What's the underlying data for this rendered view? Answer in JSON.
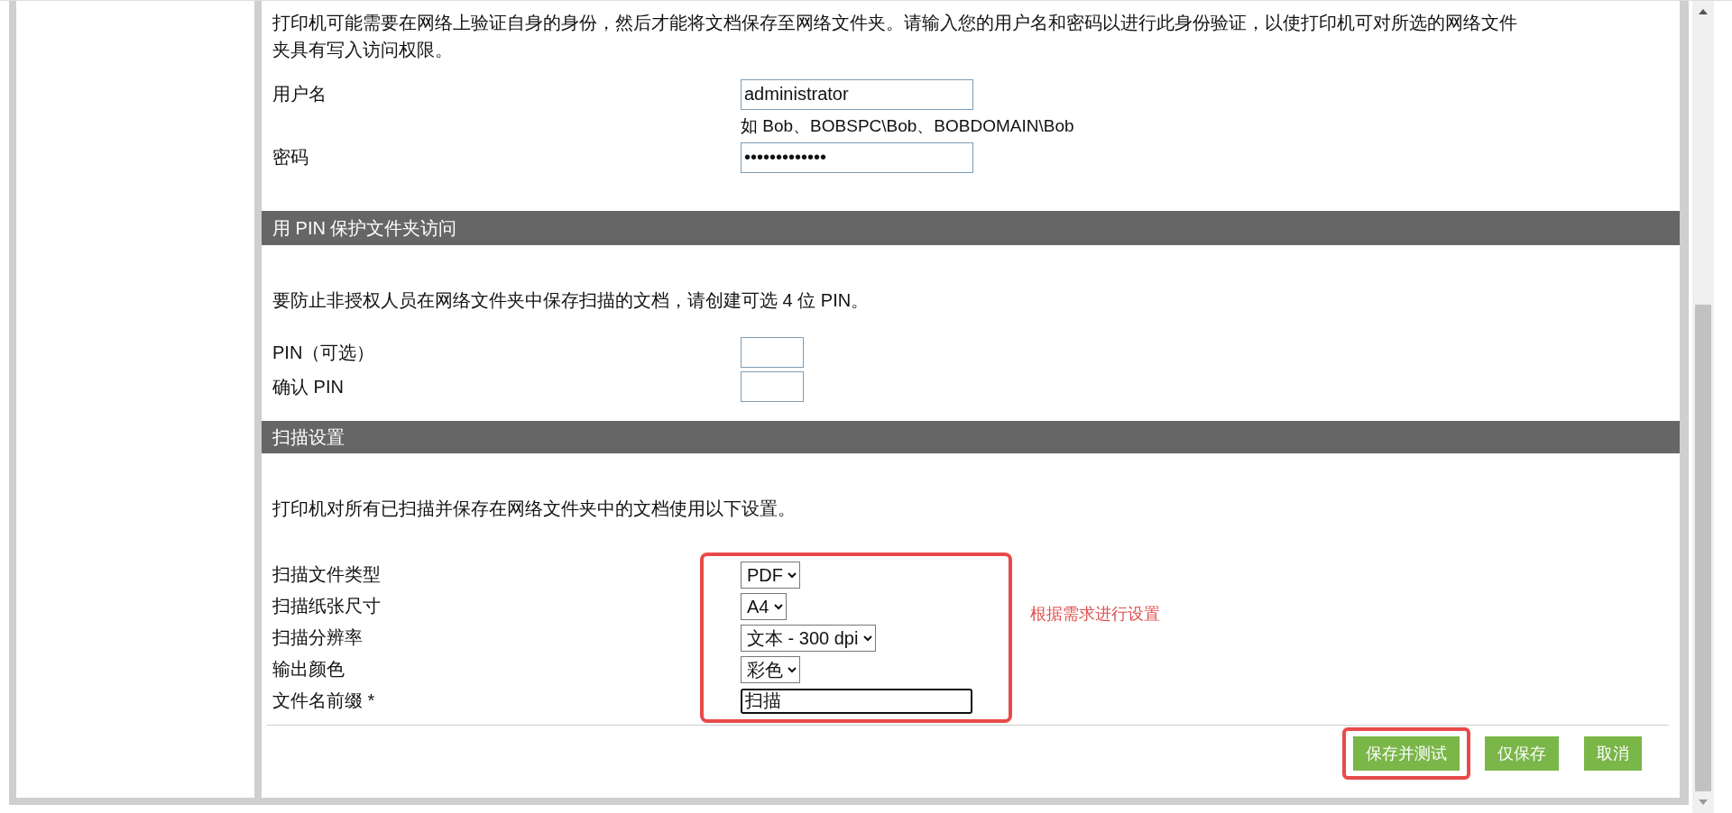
{
  "intro": "打印机可能需要在网络上验证自身的身份，然后才能将文档保存至网络文件夹。请输入您的用户名和密码以进行此身份验证，以使打印机可对所选的网络文件夹具有写入访问权限。",
  "credentials": [
    {
      "label": "用户名",
      "value": "administrator",
      "hint": "如 Bob、BOBSPC\\Bob、BOBDOMAIN\\Bob"
    },
    {
      "label": "密码",
      "value": "•••••••••••••"
    }
  ],
  "pin_section": {
    "title": "用 PIN 保护文件夹访问",
    "description": "要防止非授权人员在网络文件夹中保存扫描的文档，请创建可选 4 位 PIN。",
    "fields": [
      {
        "label": "PIN（可选）"
      },
      {
        "label": "确认 PIN"
      }
    ]
  },
  "scan_section": {
    "title": "扫描设置",
    "description": "打印机对所有已扫描并保存在网络文件夹中的文档使用以下设置。",
    "highlighted": true,
    "note": "根据需求进行设置",
    "fields": [
      {
        "label": "扫描文件类型",
        "kind": "select",
        "value": "PDF"
      },
      {
        "label": "扫描纸张尺寸",
        "kind": "select",
        "value": "A4"
      },
      {
        "label": "扫描分辨率",
        "kind": "select",
        "value": "文本 - 300 dpi"
      },
      {
        "label": "输出颜色",
        "kind": "select",
        "value": "彩色"
      },
      {
        "label": "文件名前缀 *",
        "kind": "text",
        "value": "扫描",
        "focused": true
      }
    ]
  },
  "buttons": [
    {
      "label": "保存并测试",
      "highlighted": true
    },
    {
      "label": "仅保存",
      "highlighted": false
    },
    {
      "label": "取消",
      "highlighted": false
    }
  ]
}
